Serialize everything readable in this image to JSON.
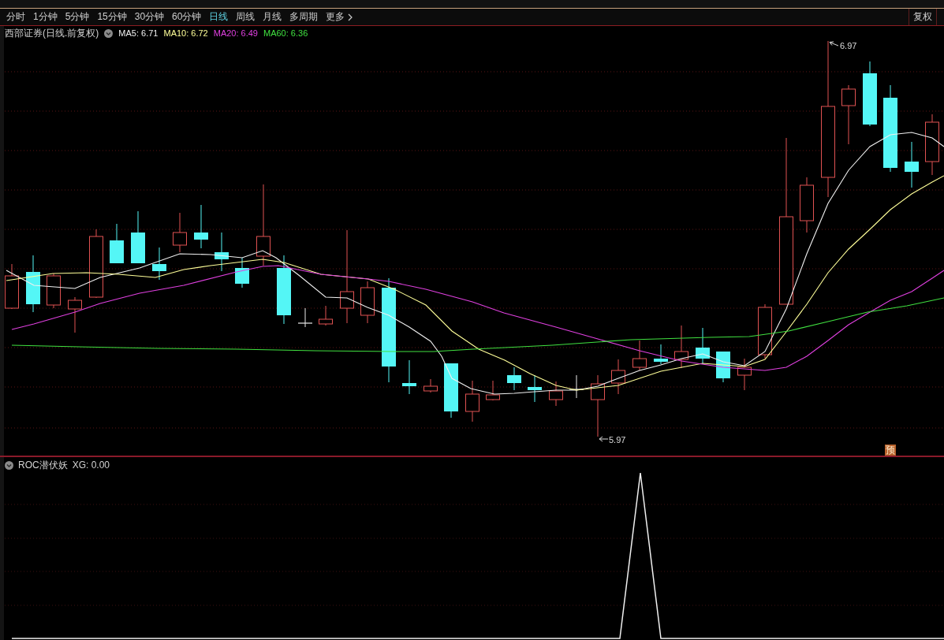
{
  "toolbar": {
    "period_tabs": [
      {
        "label": "分时",
        "selected": false,
        "kind": "period"
      },
      {
        "label": "1分钟",
        "selected": false,
        "kind": "period"
      },
      {
        "label": "5分钟",
        "selected": false,
        "kind": "period"
      },
      {
        "label": "15分钟",
        "selected": false,
        "kind": "period"
      },
      {
        "label": "30分钟",
        "selected": false,
        "kind": "period"
      },
      {
        "label": "60分钟",
        "selected": false,
        "kind": "period"
      },
      {
        "label": "日线",
        "selected": true,
        "kind": "period"
      },
      {
        "label": "周线",
        "selected": false,
        "kind": "period"
      },
      {
        "label": "月线",
        "selected": false,
        "kind": "period"
      },
      {
        "label": "多周期",
        "selected": false,
        "kind": "period"
      },
      {
        "label": "更多",
        "selected": false,
        "kind": "menu"
      }
    ],
    "right_buttons": [
      "复权"
    ]
  },
  "main_chart": {
    "title": "西部证券(日线.前复权)",
    "legend": [
      {
        "label": "MA5: 6.71",
        "color": "#f0f0f0"
      },
      {
        "label": "MA10: 6.72",
        "color": "#ffff99"
      },
      {
        "label": "MA20: 6.49",
        "color": "#e040e0"
      },
      {
        "label": "MA60: 6.36",
        "color": "#40e040"
      }
    ],
    "high_label": "6.97",
    "low_label": "5.97",
    "badge": "预"
  },
  "indicator_panel": {
    "title": "ROC潜伏妖",
    "reading": "XG: 0.00"
  }
}
